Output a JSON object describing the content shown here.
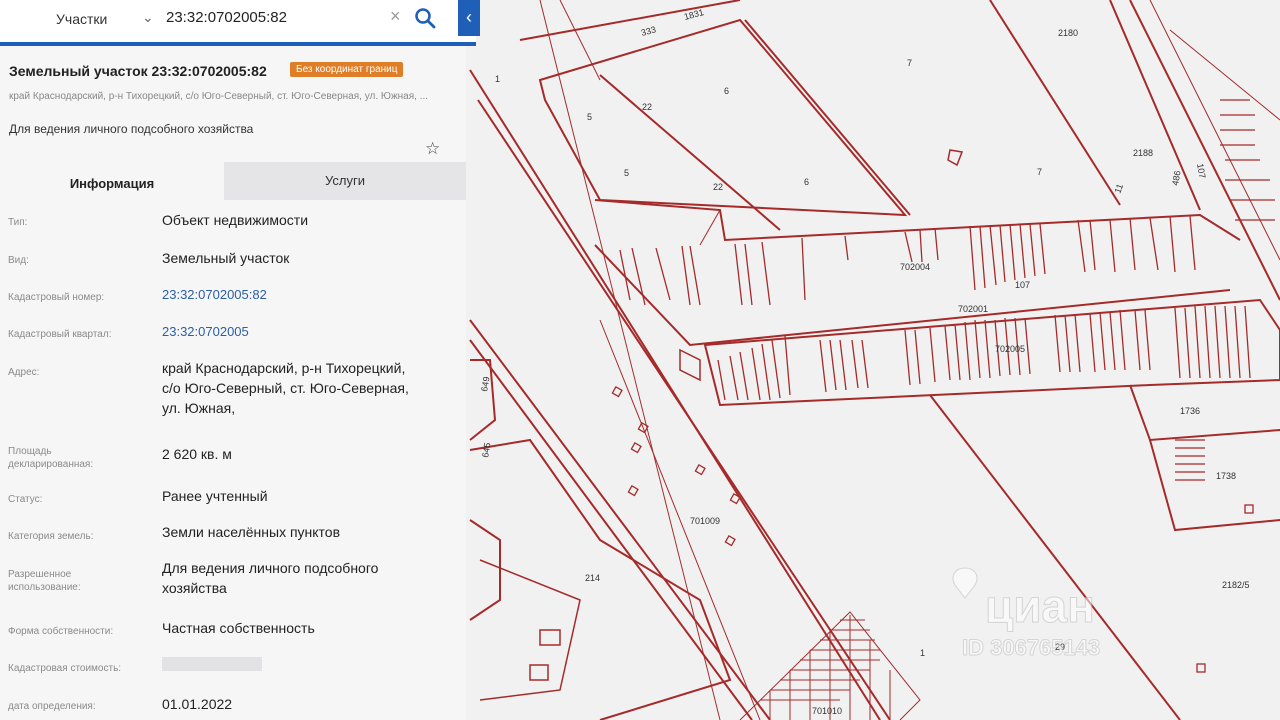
{
  "search": {
    "type_label": "Участки",
    "query": "23:32:0702005:82"
  },
  "parcel": {
    "title": "Земельный участок 23:32:0702005:82",
    "badge": "Без координат границ",
    "address_short": "край Краснодарский, р-н Тихорецкий, с/о Юго-Северный, ст. Юго-Северная, ул. Южная, ...",
    "purpose": "Для ведения личного подсобного хозяйства"
  },
  "tabs": {
    "info": "Информация",
    "services": "Услуги"
  },
  "fields": {
    "type": {
      "label": "Тип:",
      "value": "Объект недвижимости"
    },
    "kind": {
      "label": "Вид:",
      "value": "Земельный участок"
    },
    "cadnum": {
      "label": "Кадастровый номер:",
      "value": "23:32:0702005:82"
    },
    "quarter": {
      "label": "Кадастровый квартал:",
      "value": "23:32:0702005"
    },
    "address": {
      "label": "Адрес:",
      "line1": "край Краснодарский, р-н Тихорецкий,",
      "line2": "с/о Юго-Северный, ст. Юго-Северная,",
      "line3": "ул. Южная,"
    },
    "area": {
      "label1": "Площадь",
      "label2": "декларированная:",
      "value": "2 620 кв. м"
    },
    "status": {
      "label": "Статус:",
      "value": "Ранее учтенный"
    },
    "category": {
      "label": "Категория земель:",
      "value": "Земли населённых пунктов"
    },
    "usage": {
      "label1": "Разрешенное",
      "label2": "использование:",
      "value1": "Для ведения личного подсобного",
      "value2": "хозяйства"
    },
    "ownership": {
      "label": "Форма собственности:",
      "value": "Частная собственность"
    },
    "cost": {
      "label": "Кадастровая стоимость:"
    },
    "date": {
      "label": "дата определения:",
      "value": "01.01.2022"
    }
  },
  "map": {
    "labels": [
      "333",
      "1831",
      "2180",
      "1",
      "7",
      "6",
      "22",
      "5",
      "5",
      "22",
      "6",
      "7",
      "2188",
      "702004",
      "107",
      "702001",
      "702005",
      "1736",
      "1738",
      "649",
      "645",
      "701009",
      "214",
      "2182/5",
      "1",
      "29",
      "701010",
      "107",
      "486",
      "11"
    ]
  },
  "watermark": {
    "brand": "циан",
    "id": "ID 306765143"
  },
  "colors": {
    "accent": "#1f5fb8",
    "badge": "#e07e28",
    "map_lines": "#a52a2a"
  }
}
